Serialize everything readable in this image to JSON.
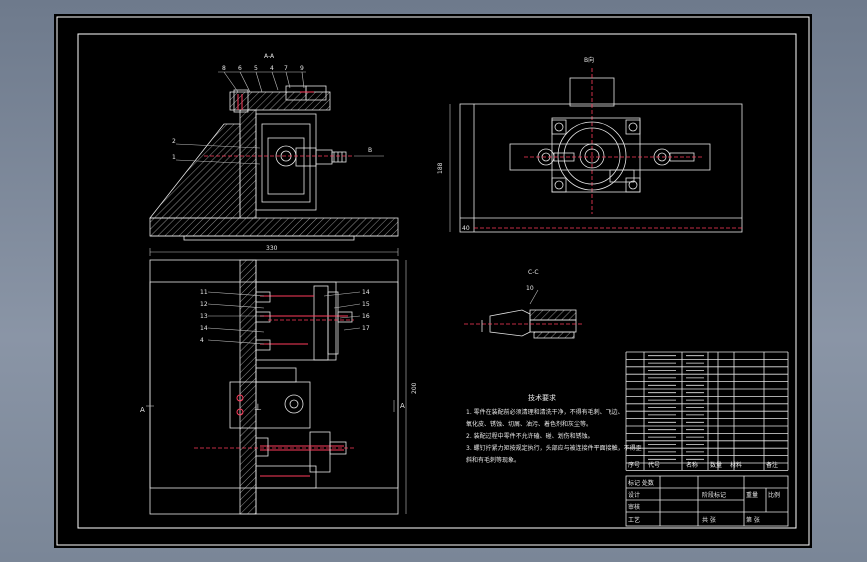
{
  "drawing": {
    "view_labels": {
      "section_aa": "A-A",
      "view_b": "B向",
      "view_c": "C-C"
    },
    "section_marks": {
      "a_left": "A",
      "a_right": "A",
      "b_arrow": "B"
    },
    "dimensions": {
      "top_width": "330",
      "right_height": "200",
      "top_view_height": "188",
      "small_40": "40"
    },
    "balloons_top": [
      "8",
      "6",
      "5",
      "4",
      "7",
      "9"
    ],
    "balloons_left": [
      "2",
      "1"
    ],
    "balloons_plan_left": [
      "11",
      "12",
      "13",
      "14",
      "4"
    ],
    "balloons_plan_right": [
      "14",
      "15",
      "16",
      "17"
    ],
    "balloon_cc": "10",
    "tech_req": {
      "title": "技术要求",
      "lines": [
        "1. 零件在装配前必须清理和清洗干净，不得有毛刺、飞边、",
        "氧化皮、锈蚀、切屑、油污、着色剂和灰尘等。",
        "2. 装配过程中零件不允许磕、碰、划伤和锈蚀。",
        "3. 螺钉拧紧力矩按规定执行，头部应与被连接件平面接触，不得歪",
        "斜和有毛刺等现象。"
      ]
    },
    "bom_footer": [
      "序号",
      "代号",
      "名称",
      "数量",
      "材料",
      "备注"
    ],
    "title_block": {
      "rows": [
        "标记 处数",
        "设计",
        "审核",
        "工艺"
      ],
      "right": [
        "阶段标记",
        "重量",
        "比例",
        "共 张",
        "第 张"
      ]
    }
  }
}
